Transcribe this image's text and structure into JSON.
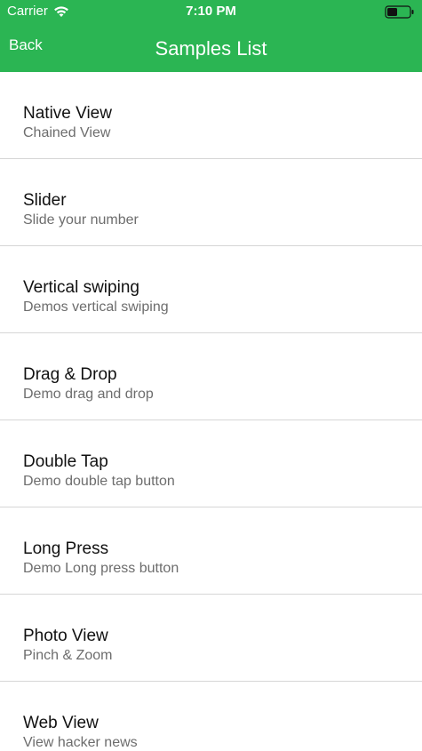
{
  "status_bar": {
    "carrier": "Carrier",
    "time": "7:10 PM",
    "wifi_icon": "wifi-icon",
    "battery_icon": "battery-icon"
  },
  "nav": {
    "back_label": "Back",
    "title": "Samples List",
    "accent_color": "#2bb553"
  },
  "list": {
    "items": [
      {
        "title": "Native View",
        "subtitle": "Chained View"
      },
      {
        "title": "Slider",
        "subtitle": "Slide your number"
      },
      {
        "title": "Vertical swiping",
        "subtitle": "Demos vertical swiping"
      },
      {
        "title": "Drag & Drop",
        "subtitle": "Demo drag and drop"
      },
      {
        "title": "Double Tap",
        "subtitle": "Demo double tap button"
      },
      {
        "title": "Long Press",
        "subtitle": "Demo Long press button"
      },
      {
        "title": "Photo View",
        "subtitle": "Pinch & Zoom"
      },
      {
        "title": "Web View",
        "subtitle": "View hacker news"
      }
    ]
  }
}
